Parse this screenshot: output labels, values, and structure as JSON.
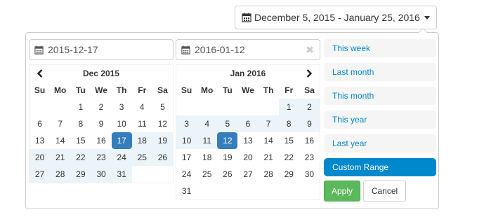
{
  "trigger": {
    "icon": "calendar-icon",
    "text": "December 5, 2015 - January 25, 2016"
  },
  "left_calendar": {
    "input_value": "2015-12-17",
    "month": "Dec 2015",
    "days_of_week": [
      "Su",
      "Mo",
      "Tu",
      "We",
      "Th",
      "Fr",
      "Sa"
    ],
    "weeks": [
      [
        "",
        "",
        "1",
        "2",
        "3",
        "4",
        "5"
      ],
      [
        "6",
        "7",
        "8",
        "9",
        "10",
        "11",
        "12"
      ],
      [
        "13",
        "14",
        "15",
        "16",
        "17",
        "18",
        "19"
      ],
      [
        "20",
        "21",
        "22",
        "23",
        "24",
        "25",
        "26"
      ],
      [
        "27",
        "28",
        "29",
        "30",
        "31",
        "",
        ""
      ]
    ]
  },
  "right_calendar": {
    "input_value": "2016-01-12",
    "month": "Jan 2016",
    "days_of_week": [
      "Su",
      "Mo",
      "Tu",
      "We",
      "Th",
      "Fr",
      "Sa"
    ],
    "weeks": [
      [
        "",
        "",
        "",
        "",
        "",
        "1",
        "2"
      ],
      [
        "3",
        "4",
        "5",
        "6",
        "7",
        "8",
        "9"
      ],
      [
        "10",
        "11",
        "12",
        "13",
        "14",
        "15",
        "16"
      ],
      [
        "17",
        "18",
        "19",
        "20",
        "21",
        "22",
        "23"
      ],
      [
        "24",
        "25",
        "26",
        "27",
        "28",
        "29",
        "30"
      ],
      [
        "31",
        "",
        "",
        "",
        "",
        "",
        ""
      ]
    ]
  },
  "ranges": [
    {
      "label": "This week",
      "active": false
    },
    {
      "label": "Last month",
      "active": false
    },
    {
      "label": "This month",
      "active": false
    },
    {
      "label": "This year",
      "active": false
    },
    {
      "label": "Last year",
      "active": false
    },
    {
      "label": "Custom Range",
      "active": true
    }
  ],
  "buttons": {
    "apply": "Apply",
    "cancel": "Cancel"
  },
  "colors": {
    "selected_day": "#357ebd",
    "in_range": "#ebf4f8",
    "range_active": "#0088cc",
    "apply": "#5cb85c"
  }
}
